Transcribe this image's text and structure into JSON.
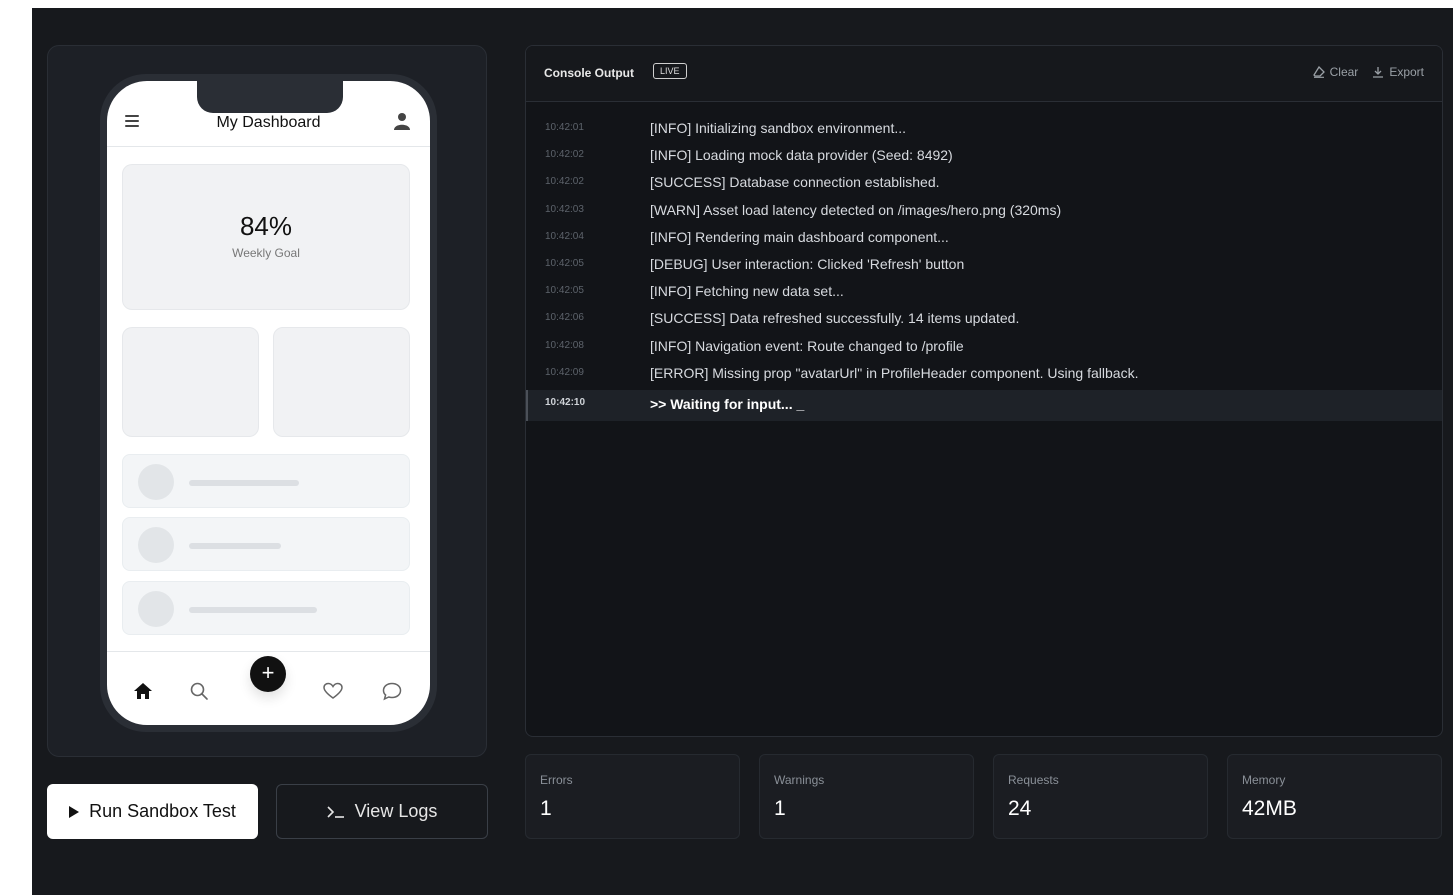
{
  "phone": {
    "title": "My Dashboard",
    "goal": {
      "value": "84%",
      "label": "Weekly Goal"
    },
    "fab_label": "+"
  },
  "buttons": {
    "run": "Run Sandbox Test",
    "logs": "View Logs"
  },
  "console": {
    "title": "Console Output",
    "badge": "LIVE",
    "clear": "Clear",
    "export": "Export",
    "logs": [
      {
        "time": "10:42:01",
        "msg": "[INFO]  Initializing sandbox environment..."
      },
      {
        "time": "10:42:02",
        "msg": "[INFO]  Loading mock data provider (Seed: 8492)"
      },
      {
        "time": "10:42:02",
        "msg": "[SUCCESS]  Database connection established."
      },
      {
        "time": "10:42:03",
        "msg": "[WARN]  Asset load latency detected on /images/hero.png (320ms)"
      },
      {
        "time": "10:42:04",
        "msg": "[INFO]  Rendering main dashboard component..."
      },
      {
        "time": "10:42:05",
        "msg": "[DEBUG]  User interaction: Clicked 'Refresh' button"
      },
      {
        "time": "10:42:05",
        "msg": "[INFO]  Fetching new data set..."
      },
      {
        "time": "10:42:06",
        "msg": "[SUCCESS]  Data refreshed successfully. 14 items updated."
      },
      {
        "time": "10:42:08",
        "msg": "[INFO]  Navigation event: Route changed to /profile"
      },
      {
        "time": "10:42:09",
        "msg": "[ERROR]  Missing prop \"avatarUrl\" in ProfileHeader component. Using fallback."
      }
    ],
    "input_line": {
      "time": "10:42:10",
      "msg": ">>   Waiting for input...  _"
    }
  },
  "stats": [
    {
      "label": "Errors",
      "value": "1"
    },
    {
      "label": "Warnings",
      "value": "1"
    },
    {
      "label": "Requests",
      "value": "24"
    },
    {
      "label": "Memory",
      "value": "42MB"
    }
  ]
}
